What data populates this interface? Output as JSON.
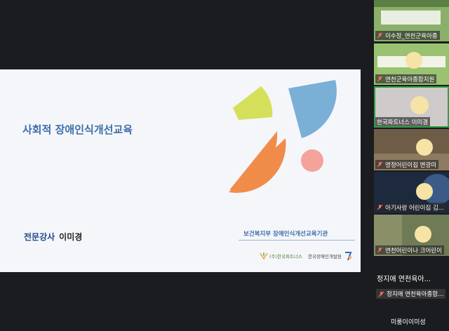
{
  "slide": {
    "title": "사회적 장애인식개선교육",
    "instructor_role": "전문강사",
    "instructor_name": "이미경",
    "organization": "보건복지부 장애인식개선교육기관",
    "logo_left": "(주)한국파트너스",
    "logo_right": "한국장애인개발원"
  },
  "participants": [
    {
      "name": "이수정_연천군육아종"
    },
    {
      "name": "연천군육아종합지원"
    },
    {
      "name": "한국파트너스 이미경"
    },
    {
      "name": "명정어린이집 변광미"
    },
    {
      "name": "아기사랑 어린이집 김..."
    },
    {
      "name": "연천어린이나 크어린이"
    }
  ],
  "more_label": "정지애 연천육아...",
  "muted_label": "정지애 연천육아종합...",
  "self_label": "미룽이이미성",
  "colors": {
    "background": "#1b1c1f",
    "slide_bg": "#f5f6fa",
    "title": "#3e6ea8",
    "shape_yellow": "#d4e05a",
    "shape_blue": "#7aafd6",
    "shape_orange": "#f08c4a",
    "shape_pink": "#f3a39a"
  },
  "icons": [
    "mic-off-icon"
  ]
}
